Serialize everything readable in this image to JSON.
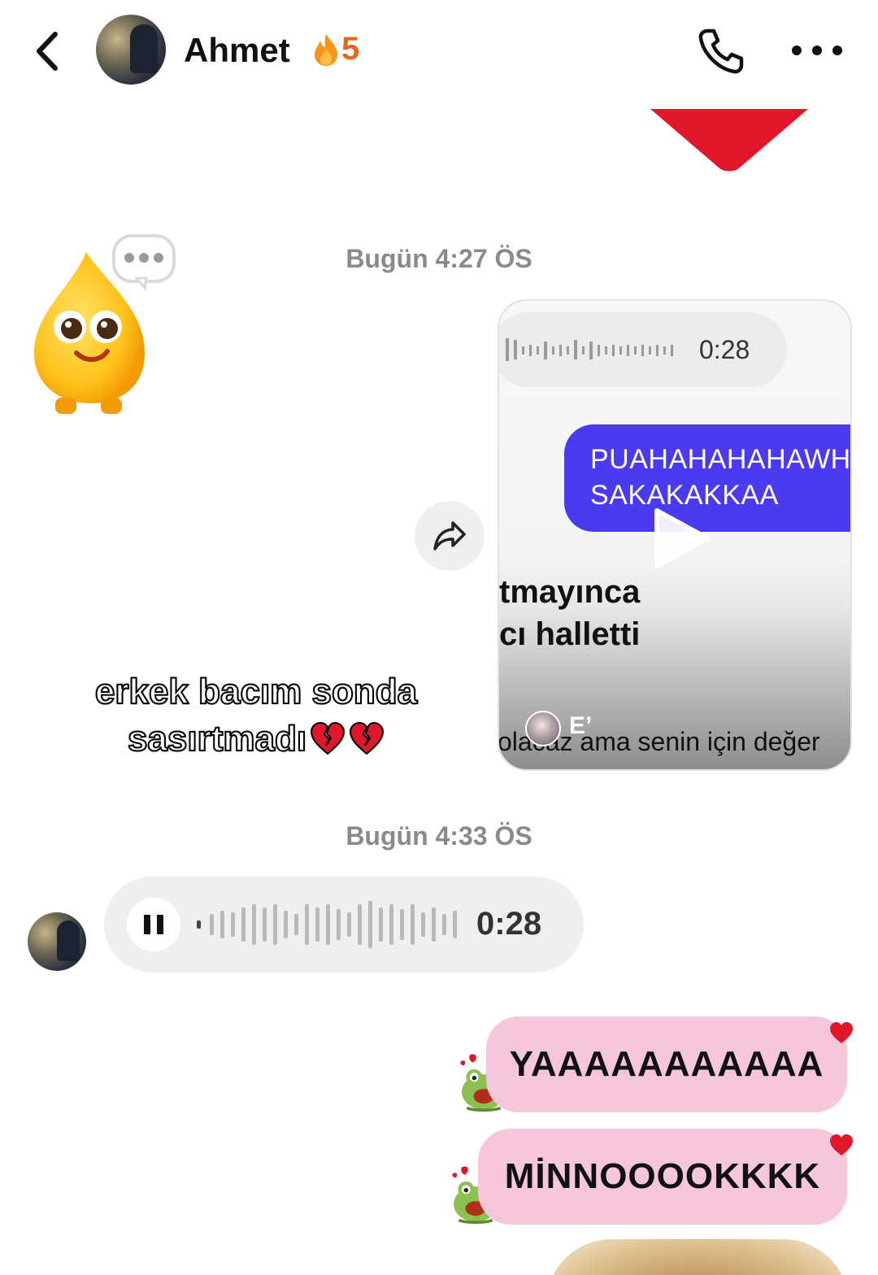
{
  "header": {
    "contact_name": "Ahmet",
    "streak_count": "5",
    "icons": [
      "back-icon",
      "avatar",
      "flame-icon",
      "phone-icon",
      "more-icon"
    ]
  },
  "timestamps": [
    "Bugün 4:27 ÖS",
    "Bugün 4:33 ÖS"
  ],
  "shared_reel": {
    "voice_duration": "0:28",
    "bubble_lines": [
      "PUAHAHAHAHAWH",
      "SAKAKAKKAA"
    ],
    "caption_lines": [
      "tmayınca",
      "cı halletti"
    ],
    "author": "E’",
    "subtitle": "olacaz ama senin için değer"
  },
  "overlay_caption": {
    "line1": "erkek bacım sonda",
    "line2": "sasırtmadı"
  },
  "voice_message": {
    "duration": "0:28",
    "state": "playing"
  },
  "messages": [
    {
      "text": "YAAAAAAAAAAA"
    },
    {
      "text": "MİNNOOOOKKKK"
    }
  ],
  "colors": {
    "sent_bubble": "#f6c6dd",
    "reel_bubble": "#4b3bf0",
    "streak": "#e8661c",
    "heart": "#e0162b"
  }
}
